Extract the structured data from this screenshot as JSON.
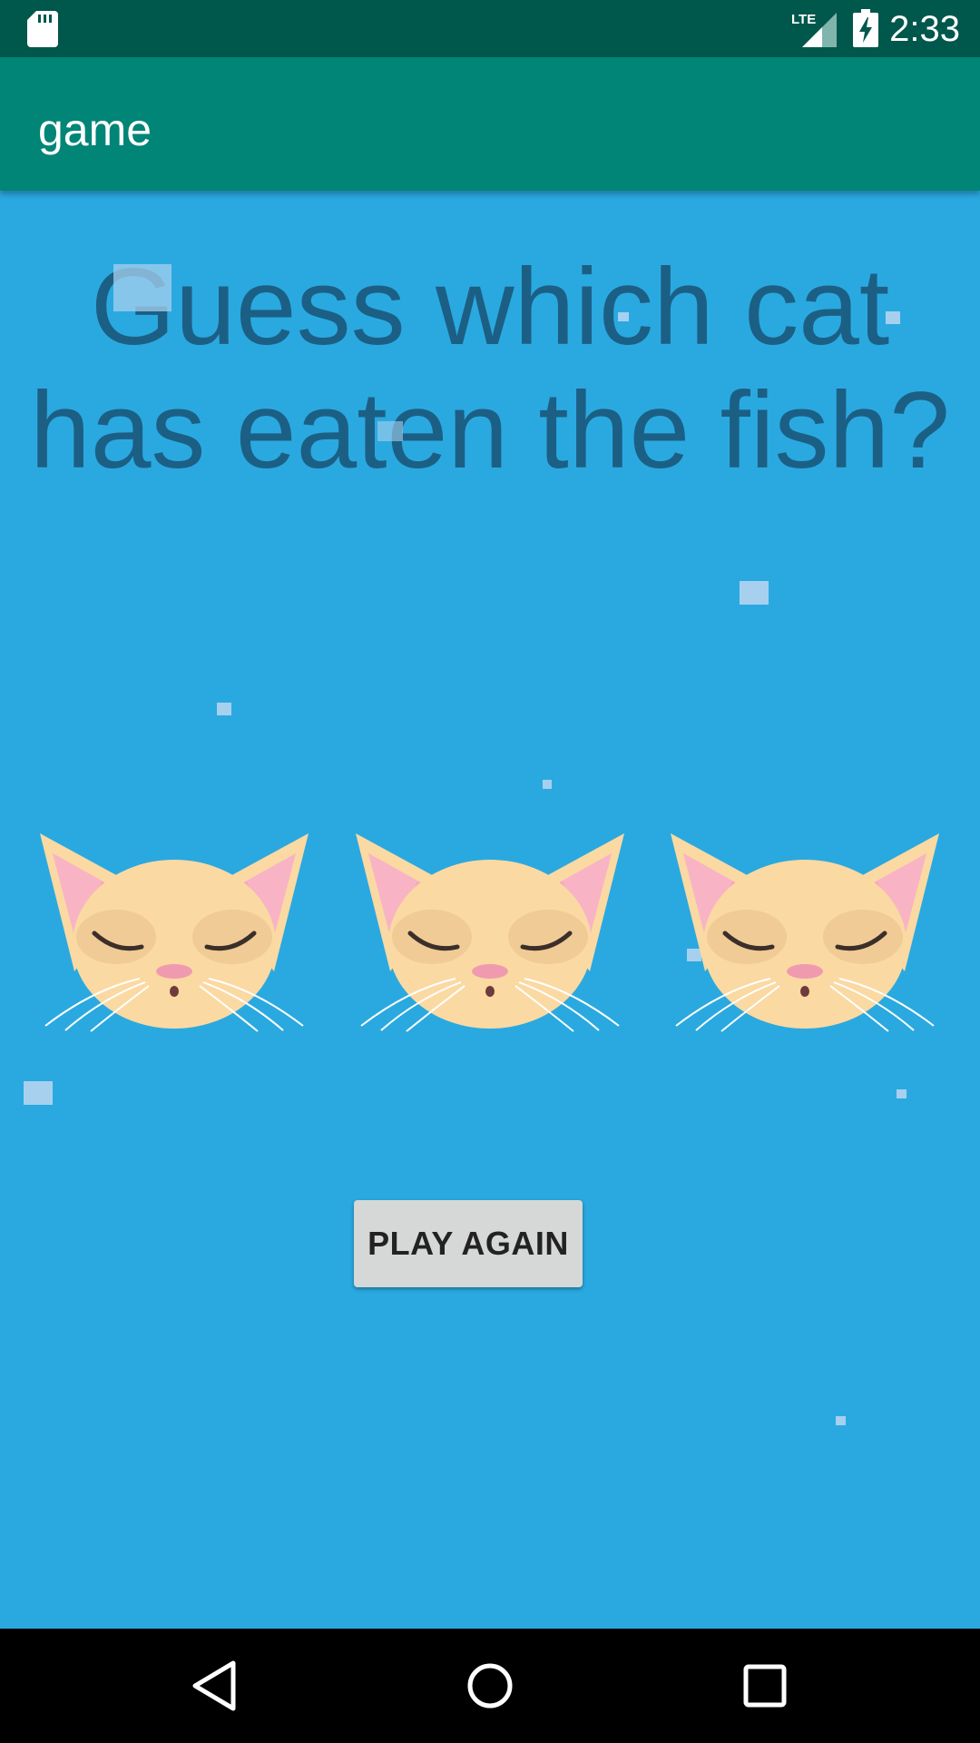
{
  "status_bar": {
    "time": "2:33",
    "network_label": "LTE",
    "icons": [
      "sd-card-icon",
      "lte-signal-icon",
      "battery-charging-icon"
    ]
  },
  "app_bar": {
    "title": "game"
  },
  "main": {
    "question": "Guess which cat has eaten the fish?",
    "cats": [
      {
        "icon": "cat-face-icon"
      },
      {
        "icon": "cat-face-icon"
      },
      {
        "icon": "cat-face-icon"
      }
    ],
    "play_again_label": "PLAY AGAIN"
  },
  "nav_bar": {
    "icons": [
      "back-icon",
      "home-icon",
      "recents-icon"
    ]
  },
  "colors": {
    "status_bar": "#00574b",
    "app_bar": "#008577",
    "background": "#2aa9e0",
    "question_text": "#1c5f85",
    "button": "#d6d7d7"
  }
}
